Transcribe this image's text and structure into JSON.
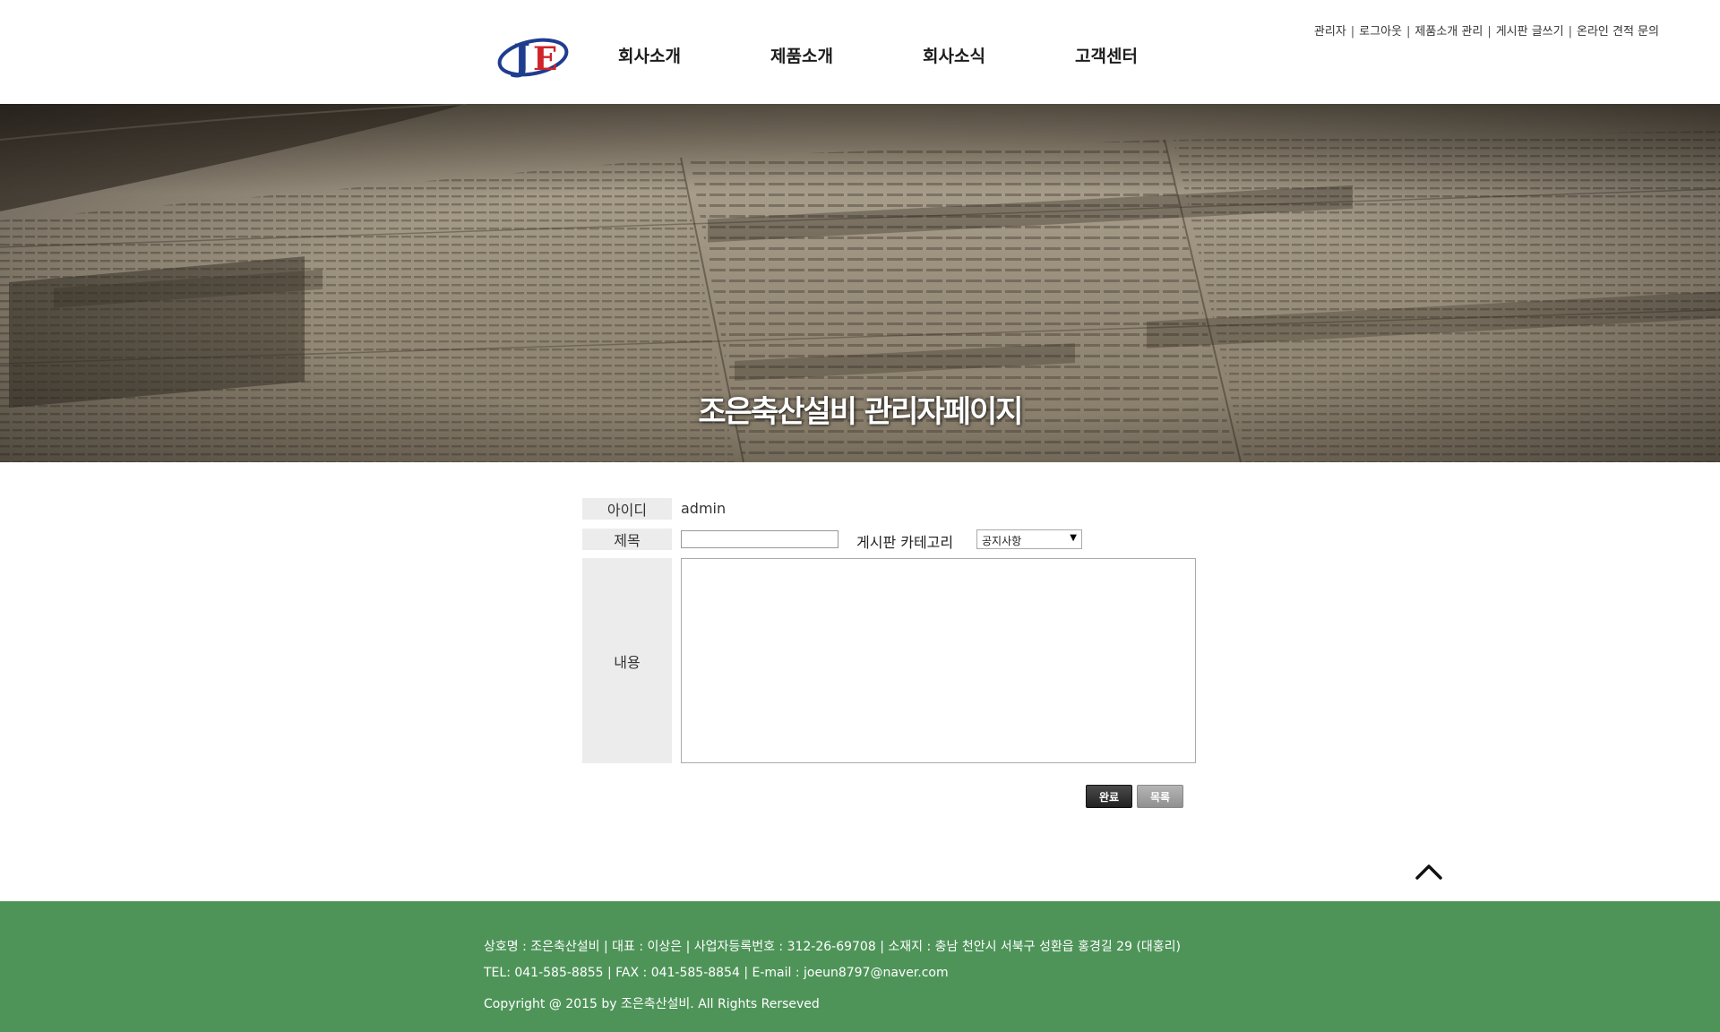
{
  "header": {
    "logo_text": "JE",
    "nav": [
      {
        "label": "회사소개"
      },
      {
        "label": "제품소개"
      },
      {
        "label": "회사소식"
      },
      {
        "label": "고객센터"
      }
    ],
    "util_links": [
      {
        "label": "관리자"
      },
      {
        "label": "로그아웃"
      },
      {
        "label": "제품소개 관리"
      },
      {
        "label": "게시판 글쓰기"
      },
      {
        "label": "온라인 견적 문의"
      }
    ],
    "util_separator": "|"
  },
  "hero": {
    "title": "조은축산설비 관리자페이지"
  },
  "form": {
    "id_label": "아이디",
    "id_value": "admin",
    "title_label": "제목",
    "title_value": "",
    "category_label": "게시판 카테고리",
    "category_selected": "공지사항",
    "content_label": "내용",
    "content_value": "",
    "submit_label": "완료",
    "list_label": "목록"
  },
  "footer": {
    "line1": "상호명 : 조은축산설비 | 대표 : 이상은 | 사업자등록번호 : 312-26-69708 | 소재지 : 충남 천안시 서북구 성환읍 홍경길 29 (대홍리)",
    "line2": "TEL: 041-585-8855 | FAX : 041-585-8854 | E-mail : joeun8797@naver.com",
    "line3": "Copyright @ 2015 by 조은축산설비. All Rights Rerseved"
  },
  "colors": {
    "footer_bg": "#4e9459",
    "logo_blue": "#1f3d8f",
    "logo_red": "#d0232a",
    "label_bg": "#ececec"
  },
  "icons": {
    "to_top": "chevron-up-icon",
    "select_arrow": "caret-down-icon"
  }
}
